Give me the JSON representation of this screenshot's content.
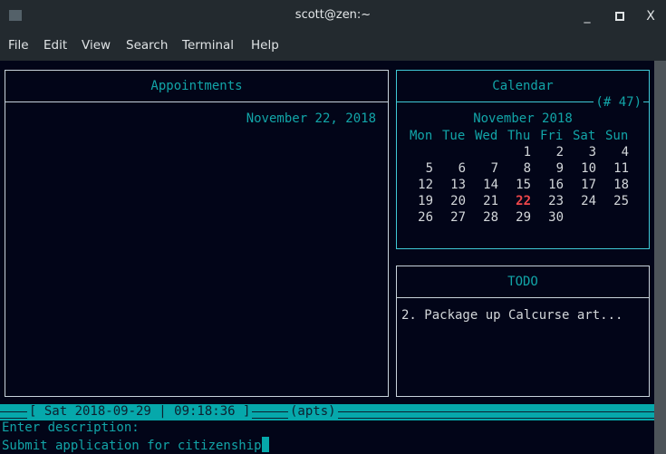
{
  "window": {
    "title": "scott@zen:~",
    "controls": {
      "minimize": "_",
      "close": "X"
    }
  },
  "menubar": [
    "File",
    "Edit",
    "View",
    "Search",
    "Terminal",
    "Help"
  ],
  "appointments": {
    "title": "Appointments",
    "date": "November 22, 2018"
  },
  "calendar": {
    "title": "Calendar",
    "week_tag": "(# 47)",
    "month": "November 2018",
    "weekdays": [
      "Mon",
      "Tue",
      "Wed",
      "Thu",
      "Fri",
      "Sat",
      "Sun"
    ],
    "weeks": [
      [
        "",
        "",
        "",
        "1",
        "2",
        "3",
        "4"
      ],
      [
        "5",
        "6",
        "7",
        "8",
        "9",
        "10",
        "11"
      ],
      [
        "12",
        "13",
        "14",
        "15",
        "16",
        "17",
        "18"
      ],
      [
        "19",
        "20",
        "21",
        "22",
        "23",
        "24",
        "25"
      ],
      [
        "26",
        "27",
        "28",
        "29",
        "30",
        "",
        ""
      ]
    ],
    "today": "22",
    "today_color": "#f0474b"
  },
  "todo": {
    "title": "TODO",
    "items": [
      "2. Package up Calcurse art..."
    ]
  },
  "statusbar": {
    "datetime": "[ Sat 2018-09-29 | 09:18:36 ]",
    "mode": "(apts)"
  },
  "prompt": {
    "label": "Enter description:",
    "value": "Submit application for citizenship"
  },
  "colors": {
    "accent": "#12a5a8",
    "status_bg": "#06a8ab",
    "background": "#020518"
  }
}
